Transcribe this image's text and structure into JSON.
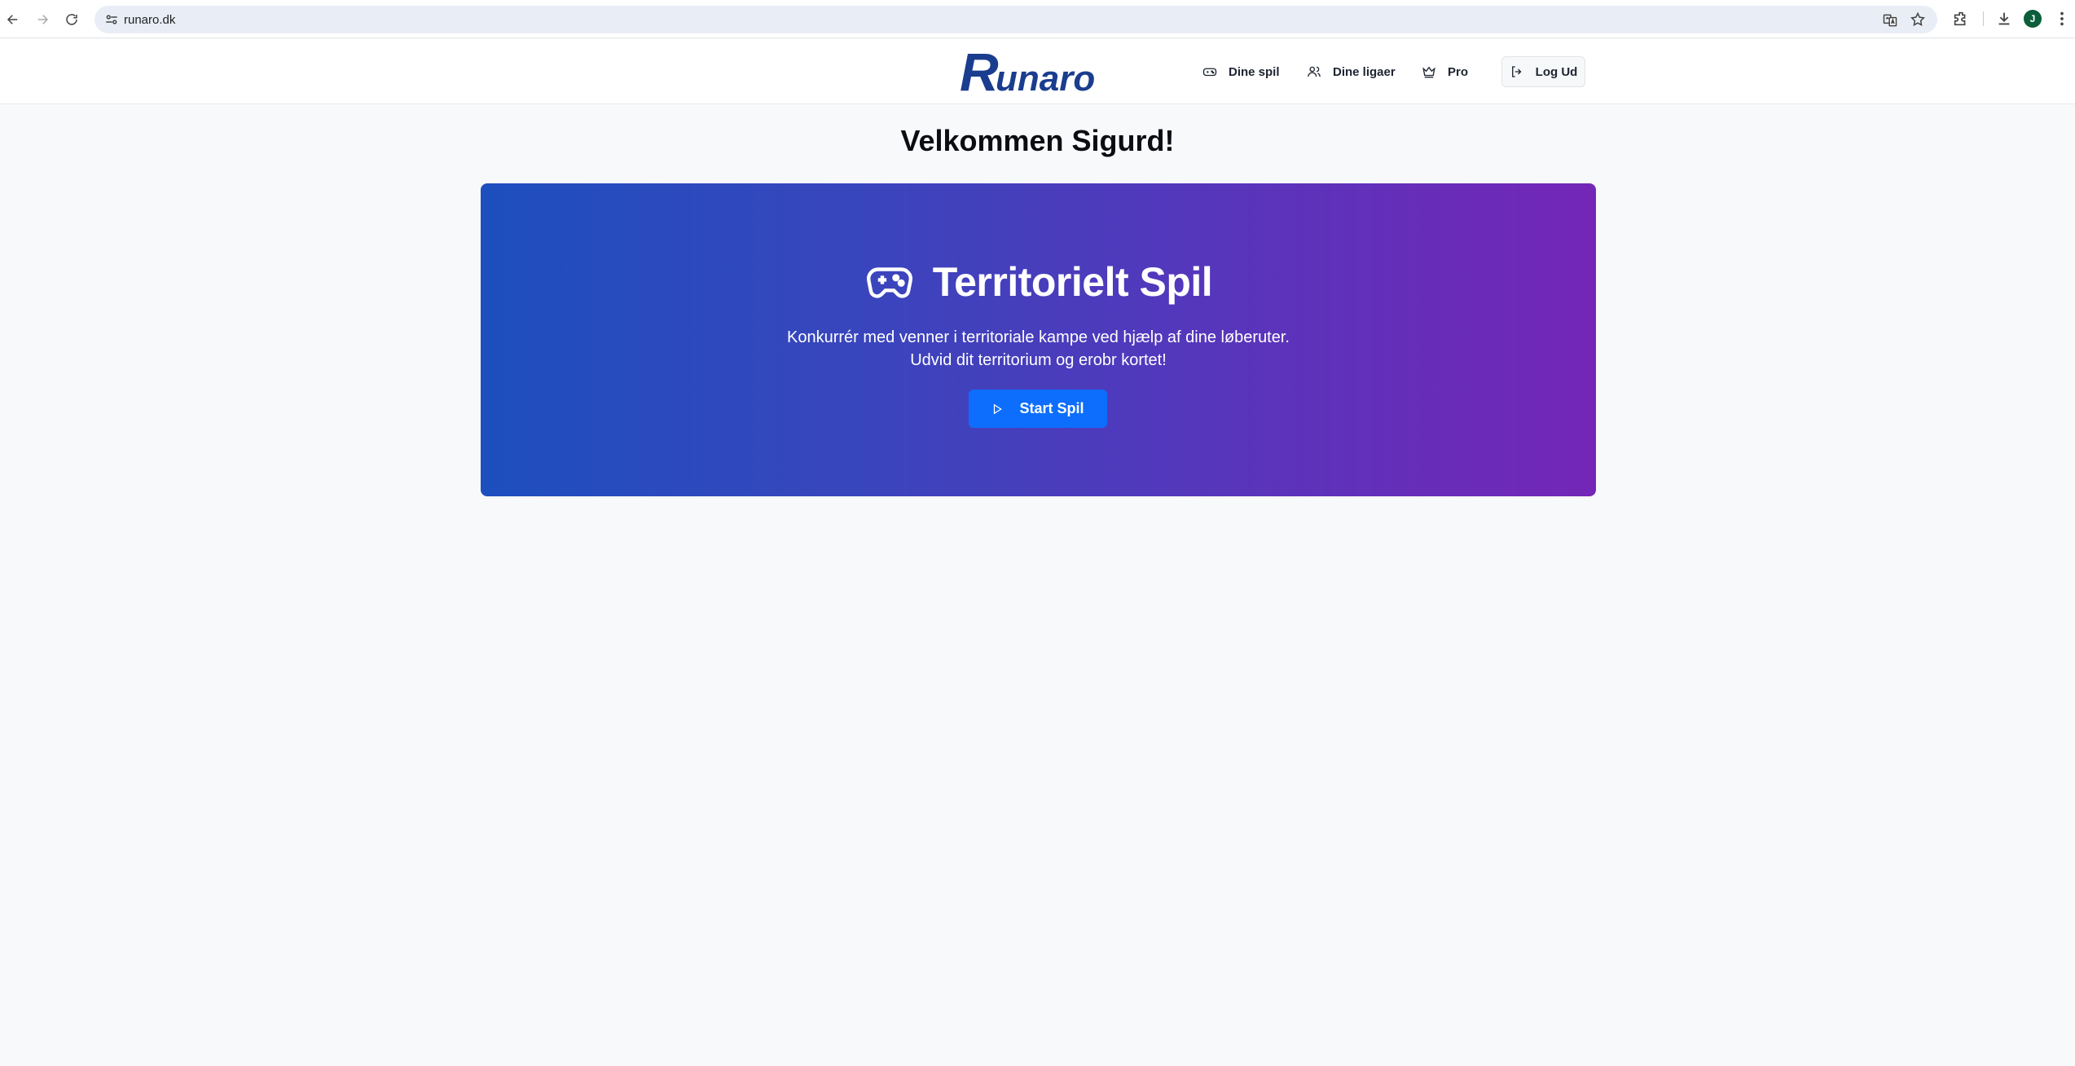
{
  "browser": {
    "url": "runaro.dk",
    "avatar_letter": "J",
    "icons": [
      "back-icon",
      "forward-icon",
      "reload-icon",
      "site-settings-icon",
      "translate-icon",
      "star-icon",
      "extensions-icon",
      "download-icon",
      "more-icon"
    ]
  },
  "header": {
    "logo_text": "Runaro",
    "nav": [
      {
        "label": "Dine spil",
        "icon": "gamepad-icon"
      },
      {
        "label": "Dine ligaer",
        "icon": "users-icon"
      },
      {
        "label": "Pro",
        "icon": "crown-icon"
      }
    ],
    "logout_label": "Log Ud",
    "logout_icon": "logout-icon"
  },
  "main": {
    "welcome": "Velkommen Sigurd!",
    "hero": {
      "title": "Territorielt Spil",
      "icon": "gamepad-icon",
      "description_line1": "Konkurrér med venner i territoriale kampe ved hjælp af dine løberuter.",
      "description_line2": "Udvid dit territorium og erobr kortet!",
      "button_label": "Start Spil",
      "button_icon": "play-icon"
    }
  },
  "colors": {
    "brand": "#1b3d8f",
    "hero_gradient_start": "#1d4fbe",
    "hero_gradient_end": "#7426b7",
    "primary_button": "#0d6efd"
  }
}
